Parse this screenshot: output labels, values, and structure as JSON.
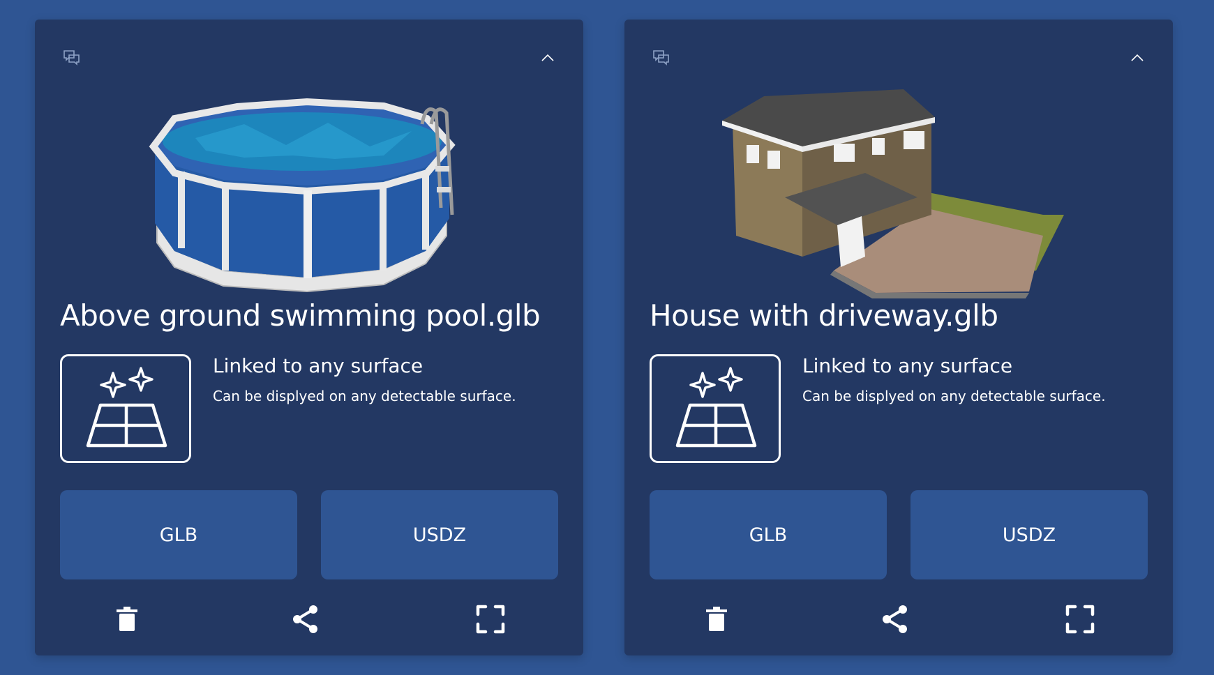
{
  "cards": [
    {
      "title": "Above ground swimming pool.glb",
      "surface_title": "Linked to any surface",
      "surface_desc": "Can be displyed on any detectable surface.",
      "glb_label": "GLB",
      "usdz_label": "USDZ",
      "preview": "above-ground-pool-3d-model",
      "icons": [
        "comment-icon",
        "chevron-up-icon",
        "surface-sparkle-icon",
        "trash-icon",
        "share-icon",
        "expand-icon"
      ]
    },
    {
      "title": "House with driveway.glb",
      "surface_title": "Linked to any surface",
      "surface_desc": "Can be displyed on any detectable surface.",
      "glb_label": "GLB",
      "usdz_label": "USDZ",
      "preview": "house-with-driveway-3d-model",
      "icons": [
        "comment-icon",
        "chevron-up-icon",
        "surface-sparkle-icon",
        "trash-icon",
        "share-icon",
        "expand-icon"
      ]
    }
  ],
  "colors": {
    "background": "#2f5593",
    "card": "#233863",
    "button": "#2f5593",
    "text": "#ffffff"
  }
}
